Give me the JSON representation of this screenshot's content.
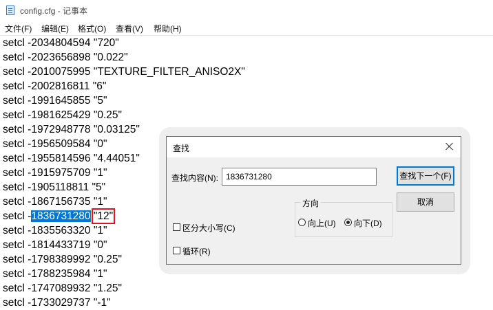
{
  "window": {
    "title": "config.cfg - 记事本",
    "icon": "notepad-icon"
  },
  "menu": [
    "文件(F)",
    "编辑(E)",
    "格式(O)",
    "查看(V)",
    "帮助(H)"
  ],
  "lines": [
    {
      "prefix": "setcl -2034804594 \"720\""
    },
    {
      "prefix": "setcl -2023656898 \"0.022\""
    },
    {
      "prefix": "setcl -2010075995 \"TEXTURE_FILTER_ANISO2X\""
    },
    {
      "prefix": "setcl -2002816811 \"6\""
    },
    {
      "prefix": "setcl -1991645855 \"5\""
    },
    {
      "prefix": "setcl -1981625429 \"0.25\""
    },
    {
      "prefix": "setcl -1972948778 \"0.03125\""
    },
    {
      "prefix": "setcl -1956509584 \"0\""
    },
    {
      "prefix": "setcl -1955814596 \"4.44051\""
    },
    {
      "prefix": "setcl -1915975709 \"1\""
    },
    {
      "prefix": "setcl -1905118811 \"5\""
    },
    {
      "prefix": "setcl -1867156735 \"1\""
    },
    {
      "prefix": "setcl -",
      "selected": "1836731280",
      "space": " ",
      "boxed": "\"12\""
    },
    {
      "prefix": "setcl -1835563320 \"1\""
    },
    {
      "prefix": "setcl -1814433719 \"0\""
    },
    {
      "prefix": "setcl -1798389992 \"0.25\""
    },
    {
      "prefix": "setcl -1788235984 \"1\""
    },
    {
      "prefix": "setcl -1747089932 \"1.25\""
    },
    {
      "prefix": "setcl -1733029737 \"-1\""
    }
  ],
  "find_dialog": {
    "title": "查找",
    "find_label": "查找内容(N):",
    "find_value": "1836731280",
    "find_next": "查找下一个(F)",
    "cancel": "取消",
    "direction_label": "方向",
    "up_label": "向上(U)",
    "down_label": "向下(D)",
    "direction_selected": "down",
    "match_case_label": "区分大小写(C)",
    "match_case_checked": false,
    "wrap_label": "循环(R)",
    "wrap_checked": false
  },
  "colors": {
    "selection": "#0078d7",
    "highlight_box": "#e0141e",
    "dialog_bg": "#f0f0f0"
  }
}
